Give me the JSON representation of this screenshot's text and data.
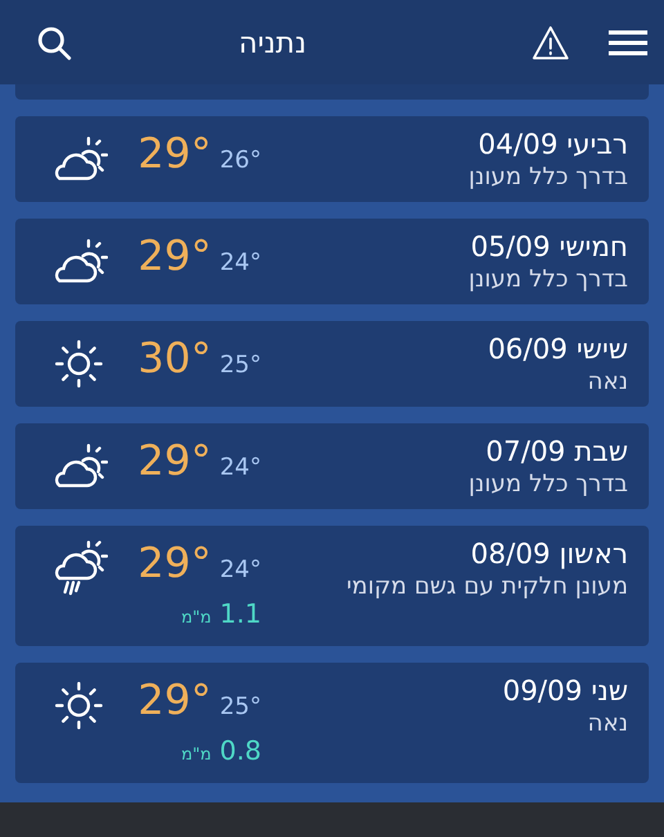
{
  "header": {
    "title": "נתניה"
  },
  "days": [
    {
      "day": "רביעי 04/09",
      "description": "בדרך כלל מעונן",
      "high": "29°",
      "low": "26°",
      "kind": "partly-cloudy"
    },
    {
      "day": "חמישי 05/09",
      "description": "בדרך כלל מעונן",
      "high": "29°",
      "low": "24°",
      "kind": "partly-cloudy"
    },
    {
      "day": "שישי 06/09",
      "description": "נאה",
      "high": "30°",
      "low": "25°",
      "kind": "sunny"
    },
    {
      "day": "שבת 07/09",
      "description": "בדרך כלל מעונן",
      "high": "29°",
      "low": "24°",
      "kind": "partly-cloudy"
    },
    {
      "day": "ראשון 08/09",
      "description": "מעונן חלקית עם גשם מקומי",
      "high": "29°",
      "low": "24°",
      "kind": "rain",
      "rain_amount": "1.1",
      "rain_unit": "מ\"מ"
    },
    {
      "day": "שני 09/09",
      "description": "נאה",
      "high": "29°",
      "low": "25°",
      "kind": "sunny",
      "rain_amount": "0.8",
      "rain_unit": "מ\"מ"
    }
  ]
}
